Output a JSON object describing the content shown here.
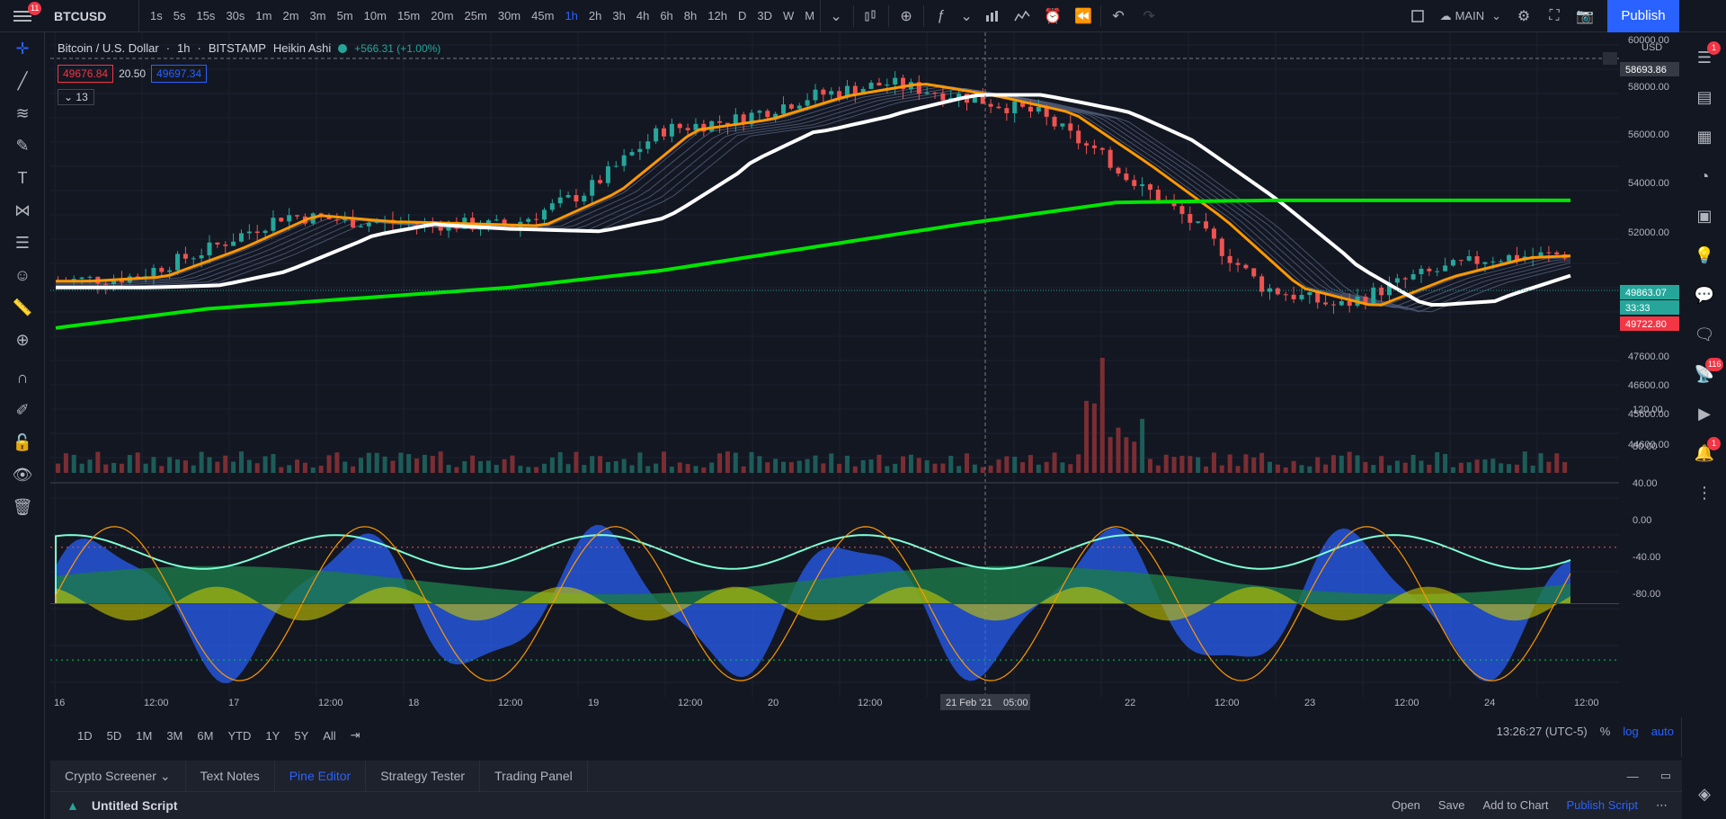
{
  "header": {
    "menu_badge": "11",
    "symbol": "BTCUSD",
    "intervals": [
      "1s",
      "5s",
      "15s",
      "30s",
      "1m",
      "2m",
      "3m",
      "5m",
      "10m",
      "15m",
      "20m",
      "25m",
      "30m",
      "45m",
      "1h",
      "2h",
      "3h",
      "4h",
      "6h",
      "8h",
      "12h",
      "D",
      "3D",
      "W",
      "M"
    ],
    "active_interval": "1h",
    "layout_name": "MAIN",
    "publish_label": "Publish"
  },
  "legend": {
    "title": "Bitcoin / U.S. Dollar",
    "interval": "1h",
    "exchange": "BITSTAMP",
    "chart_style": "Heikin Ashi",
    "change": "+566.31 (+1.00%)",
    "bid": "49676.84",
    "spread": "20.50",
    "ask": "49697.34",
    "indicators_count": "13",
    "currency": "USD"
  },
  "price_axis": {
    "ticks": [
      "60000.00",
      "58000.00",
      "56000.00",
      "54000.00",
      "52000.00",
      "47600.00",
      "46600.00",
      "45600.00",
      "44600.00"
    ],
    "crosshair_price": "58693.86",
    "last_price": "49863.07",
    "countdown": "33:33",
    "prev_price": "49722.80",
    "osc_ticks": [
      "120.00",
      "80.00",
      "40.00",
      "0.00",
      "-40.00",
      "-80.00"
    ]
  },
  "time_axis": {
    "labels": [
      "16",
      "12:00",
      "17",
      "12:00",
      "18",
      "12:00",
      "19",
      "12:00",
      "20",
      "12:00",
      "21 Feb '21",
      "05:00",
      "22",
      "12:00",
      "23",
      "12:00",
      "24",
      "12:00"
    ]
  },
  "ranges": [
    "1D",
    "5D",
    "1M",
    "3M",
    "6M",
    "YTD",
    "1Y",
    "5Y",
    "All"
  ],
  "clock": "13:26:27 (UTC-5)",
  "scale_opts": [
    "%",
    "log",
    "auto"
  ],
  "bottom_tabs": [
    "Crypto Screener",
    "Text Notes",
    "Pine Editor",
    "Strategy Tester",
    "Trading Panel"
  ],
  "active_tab": "Pine Editor",
  "editor": {
    "script_name": "Untitled Script",
    "actions": [
      "Open",
      "Save",
      "Add to Chart",
      "Publish Script"
    ]
  },
  "right_badges": {
    "watchlist": "1",
    "chat": "116",
    "alerts": "1"
  },
  "chart_data": {
    "type": "line",
    "series": [
      {
        "name": "",
        "x_pct": [
          0,
          5,
          10,
          15,
          20,
          25,
          30,
          35,
          40,
          45,
          50,
          55,
          60,
          65,
          70,
          75,
          80,
          85,
          90,
          95,
          100
        ],
        "values": [
          48600,
          48800,
          50100,
          51700,
          51400,
          51300,
          51200,
          52800,
          55700,
          56200,
          57300,
          57900,
          57300,
          56500,
          54100,
          51500,
          48300,
          47400,
          48800,
          49700,
          49860
        ]
      },
      {
        "name": "",
        "x_pct": [
          0,
          10,
          20,
          30,
          40,
          50,
          60,
          70,
          80,
          90,
          100
        ],
        "values": [
          46400,
          47300,
          47800,
          48300,
          49100,
          50200,
          51300,
          52300,
          52400,
          52400,
          52400
        ]
      }
    ],
    "ylim": [
      43600,
      60300
    ],
    "oscillator": {
      "ylim": [
        -100,
        120
      ]
    }
  }
}
